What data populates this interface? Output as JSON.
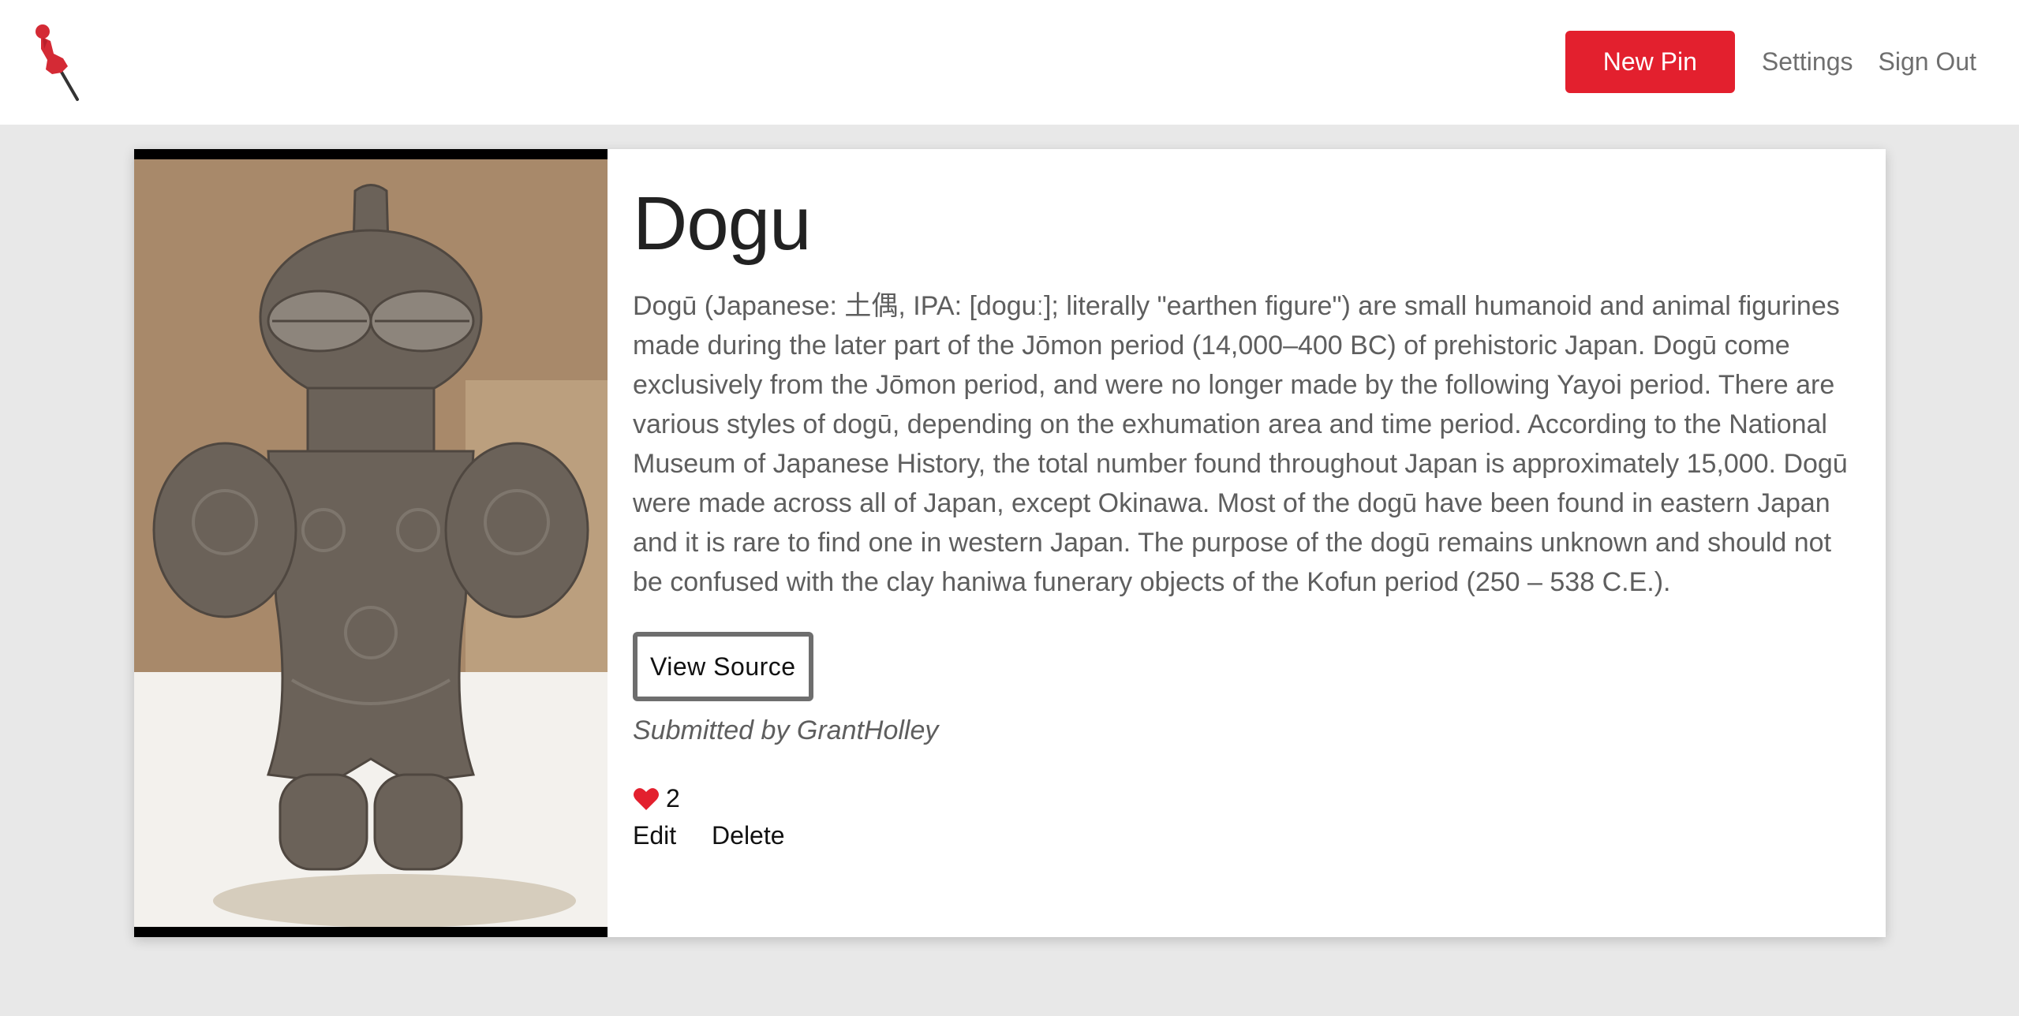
{
  "navbar": {
    "new_pin_label": "New Pin",
    "settings_label": "Settings",
    "sign_out_label": "Sign Out",
    "brand_color": "#e3202e"
  },
  "pin": {
    "title": "Dogu",
    "description": "Dogū (Japanese: 土偶, IPA: [doguː]; literally \"earthen figure\") are small humanoid and animal figurines made during the later part of the Jōmon period (14,000–400 BC) of prehistoric Japan. Dogū come exclusively from the Jōmon period, and were no longer made by the following Yayoi period. There are various styles of dogū, depending on the exhumation area and time period. According to the National Museum of Japanese History, the total number found throughout Japan is approximately 15,000. Dogū were made across all of Japan, except Okinawa. Most of the dogū have been found in eastern Japan and it is rare to find one in western Japan. The purpose of the dogū remains unknown and should not be confused with the clay haniwa funerary objects of the Kofun period (250 – 538 C.E.).",
    "view_source_label": "View Source",
    "submitted_by": "Submitted by GrantHolley",
    "like_count": "2",
    "edit_label": "Edit",
    "delete_label": "Delete",
    "icons": {
      "logo": "pushpin-icon",
      "like": "heart-icon"
    }
  }
}
